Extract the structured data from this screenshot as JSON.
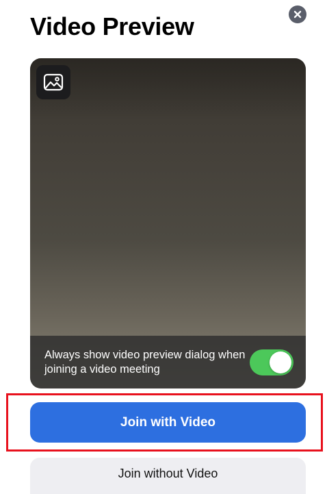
{
  "dialog": {
    "title": "Video Preview",
    "close_icon": "close-icon"
  },
  "preview": {
    "photo_icon": "image-icon",
    "always_show_label": "Always show video preview dialog when joining a video meeting",
    "always_show_enabled": true
  },
  "actions": {
    "join_with_video": "Join with Video",
    "join_without_video": "Join without Video"
  },
  "colors": {
    "primary_button": "#2d6fe0",
    "secondary_button": "#eeeef2",
    "toggle_on": "#4cc85a",
    "highlight_border": "#e8111d",
    "close_button": "#5a5e6a"
  }
}
